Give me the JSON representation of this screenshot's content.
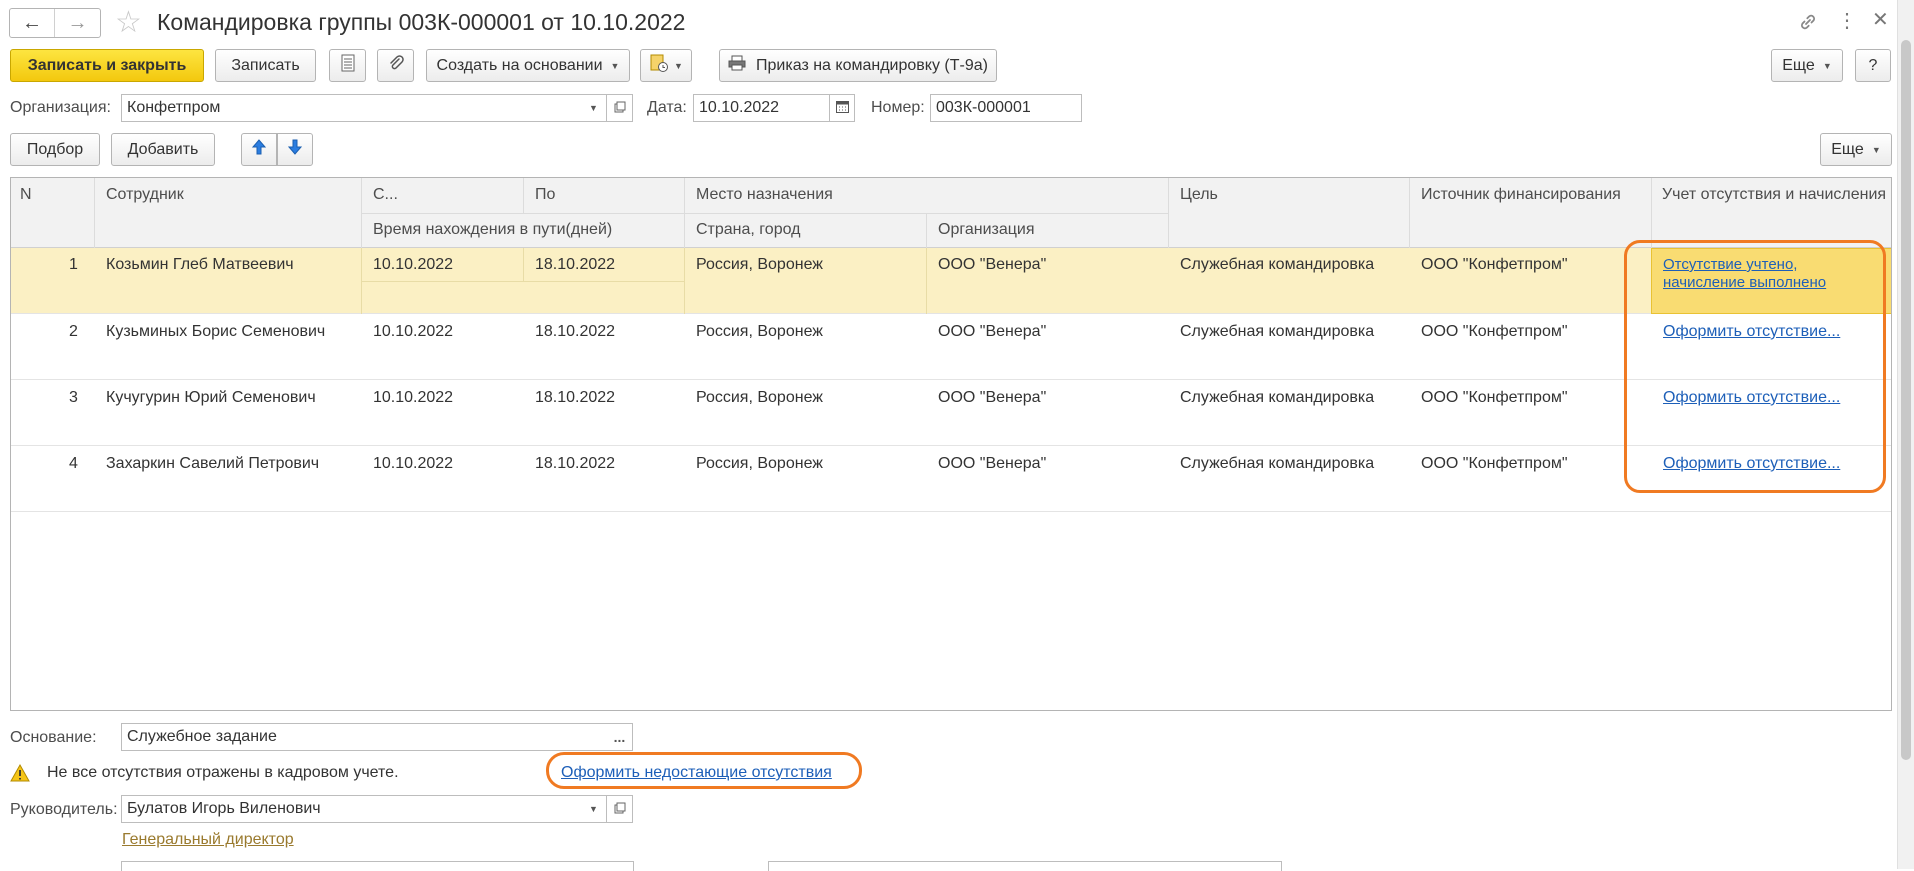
{
  "window": {
    "title": "Командировка группы 003К-000001 от 10.10.2022"
  },
  "toolbar": {
    "save_close": "Записать и закрыть",
    "save": "Записать",
    "create_based": "Создать на основании",
    "print_order": "Приказ на командировку (Т-9а)",
    "more": "Еще",
    "help": "?"
  },
  "header_fields": {
    "org_label": "Организация:",
    "org_value": "Конфетпром",
    "date_label": "Дата:",
    "date_value": "10.10.2022",
    "number_label": "Номер:",
    "number_value": "003К-000001"
  },
  "table_toolbar": {
    "pick": "Подбор",
    "add": "Добавить",
    "more": "Еще"
  },
  "table": {
    "columns": {
      "n": "N",
      "employee": "Сотрудник",
      "from": "С...",
      "to": "По",
      "travel_time": "Время нахождения в пути(дней)",
      "destination": "Место назначения",
      "country_city": "Страна, город",
      "organization": "Организация",
      "purpose": "Цель",
      "financing": "Источник финансирования",
      "absence": "Учет отсутствия и начисления"
    },
    "rows": [
      {
        "n": "1",
        "employee": "Козьмин Глеб Матвеевич",
        "from": "10.10.2022",
        "to": "18.10.2022",
        "city": "Россия, Воронеж",
        "org": "ООО \"Венера\"",
        "purpose": "Служебная командировка",
        "financing": "ООО \"Конфетпром\"",
        "absence_line1": "Отсутствие учтено,",
        "absence_line2": "начисление выполнено"
      },
      {
        "n": "2",
        "employee": "Кузьминых Борис Семенович",
        "from": "10.10.2022",
        "to": "18.10.2022",
        "city": "Россия, Воронеж",
        "org": "ООО \"Венера\"",
        "purpose": "Служебная командировка",
        "financing": "ООО \"Конфетпром\"",
        "absence_line1": "Оформить отсутствие...",
        "absence_line2": ""
      },
      {
        "n": "3",
        "employee": "Кучугурин Юрий Семенович",
        "from": "10.10.2022",
        "to": "18.10.2022",
        "city": "Россия, Воронеж",
        "org": "ООО \"Венера\"",
        "purpose": "Служебная командировка",
        "financing": "ООО \"Конфетпром\"",
        "absence_line1": "Оформить отсутствие...",
        "absence_line2": ""
      },
      {
        "n": "4",
        "employee": "Захаркин Савелий Петрович",
        "from": "10.10.2022",
        "to": "18.10.2022",
        "city": "Россия, Воронеж",
        "org": "ООО \"Венера\"",
        "purpose": "Служебная командировка",
        "financing": "ООО \"Конфетпром\"",
        "absence_line1": "Оформить отсутствие...",
        "absence_line2": ""
      }
    ]
  },
  "footer": {
    "basis_label": "Основание:",
    "basis_value": "Служебное задание",
    "basis_btn": "...",
    "warning_text": "Не все отсутствия отражены в кадровом учете.",
    "warning_link": "Оформить недостающие отсутствия",
    "head_label": "Руководитель:",
    "head_value": "Булатов Игорь Виленович",
    "head_position": "Генеральный директор"
  },
  "colors": {
    "accent_yellow": "#f5cf1a",
    "selected_row": "#fbf0c4",
    "annotation_orange": "#f07a22",
    "link_blue": "#1d5fb8"
  }
}
